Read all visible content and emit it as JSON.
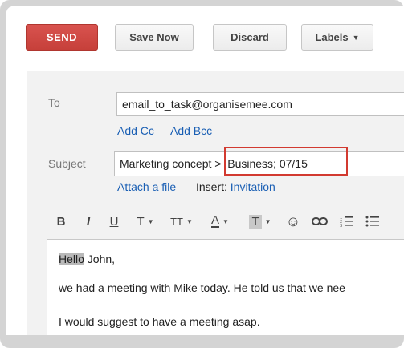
{
  "toolbar": {
    "send_label": "SEND",
    "save_now_label": "Save Now",
    "discard_label": "Discard",
    "labels_label": "Labels"
  },
  "to": {
    "label": "To",
    "value": "email_to_task@organisemee.com",
    "add_cc": "Add Cc",
    "add_bcc": "Add Bcc"
  },
  "subject": {
    "label": "Subject",
    "value_part1": "Marketing concept",
    "value_part2": " >  Business; 07/15",
    "attach_file": "Attach a file",
    "insert_prefix": "Insert:",
    "insert_invitation": "Invitation"
  },
  "format_bar": {
    "bold": "B",
    "italic": "I",
    "underline": "U",
    "font": "T",
    "size": "TT",
    "text_color": "A",
    "bg_color": "T"
  },
  "body": {
    "greeting_highlight": "Hello",
    "greeting_rest": " John,",
    "line2": "we had a meeting with Mike today. He told us that we nee",
    "line3": "I would suggest to have a meeting asap."
  },
  "colors": {
    "send_button": "#cc4a44",
    "highlight_border": "#d23a30",
    "link": "#1a5fb4"
  }
}
